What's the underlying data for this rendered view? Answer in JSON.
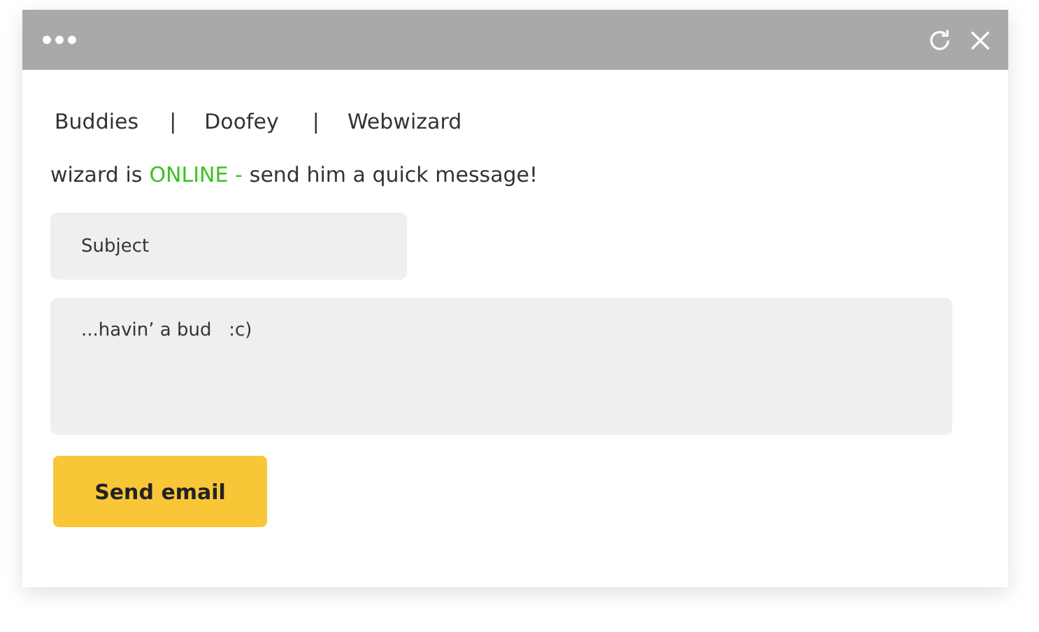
{
  "window": {
    "controls": [
      {
        "kind": "refresh"
      },
      {
        "kind": "close"
      }
    ]
  },
  "breadcrumbs": [
    {
      "kind": "link",
      "label": "Buddies"
    },
    {
      "kind": "separator",
      "label": "|"
    },
    {
      "kind": "link",
      "label": "Doofey"
    },
    {
      "kind": "separator",
      "label": "|"
    },
    {
      "kind": "link",
      "label": "Webwizard"
    }
  ],
  "status": {
    "lead": "wizard is",
    "state": "ONLINE -",
    "online": true,
    "message": "send him a quick message!"
  },
  "subject": {
    "placeholder": "Subject"
  },
  "message": {
    "value": "...havin’ a bud   :c)"
  },
  "buttons": [
    {
      "label": "Send email"
    }
  ]
}
